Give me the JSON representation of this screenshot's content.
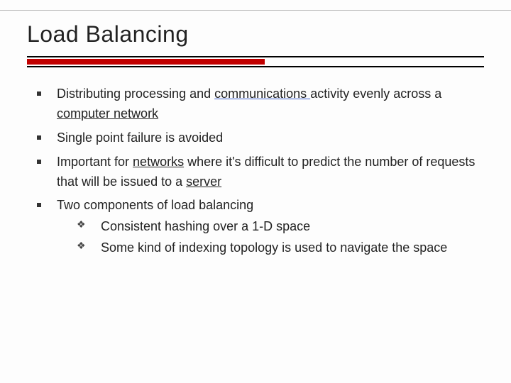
{
  "title": "Load Balancing",
  "bullets": {
    "b1": {
      "pre": "Distributing processing and ",
      "link1": "communications ",
      "mid": "activity evenly across a ",
      "link2": "computer network"
    },
    "b2": "Single point failure is avoided",
    "b3": {
      "pre": "Important for ",
      "link1": "networks",
      "mid": " where it's difficult to predict the number of requests that will be issued to a ",
      "link2": "server"
    },
    "b4": "Two components of load balancing",
    "sub": {
      "s1": "Consistent hashing over a 1-D space",
      "s2": "Some kind of indexing topology is used to navigate the space"
    }
  }
}
